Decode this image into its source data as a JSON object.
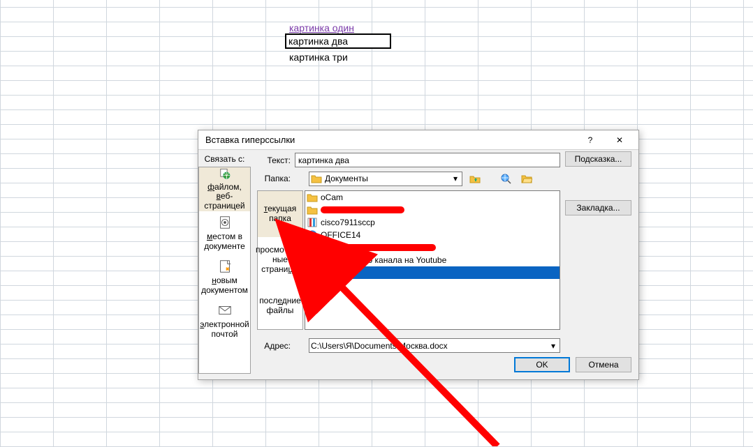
{
  "cells": {
    "c1": "картинка один",
    "c2": "картинка два",
    "c3": "картинка три"
  },
  "dialog": {
    "title": "Вставка гиперссылки",
    "help": "?",
    "close": "✕",
    "link_with_label": "Связать с:",
    "linkTargets": {
      "file": "файлом, веб-страницей",
      "place": "местом в документе",
      "new": "новым документом",
      "email": "электронной почтой"
    },
    "text_label": "Текст:",
    "text_value": "картинка два",
    "tip_btn": "Подсказка...",
    "folder_label": "Папка:",
    "folder_value": "Документы",
    "tabs": {
      "current": "текущая папка",
      "visited": "просмотренные страницы",
      "recent": "последние файлы"
    },
    "bookmark_btn": "Закладка...",
    "files": {
      "f1": "oCam",
      "f3": "cisco7911sccp",
      "f4": "OFFICE14",
      "f6": "Значок моего канала на Youtube",
      "f7": "Москва"
    },
    "address_label": "Адрес:",
    "address_value": "C:\\Users\\Я\\Documents\\Москва.docx",
    "ok": "OK",
    "cancel": "Отмена"
  }
}
